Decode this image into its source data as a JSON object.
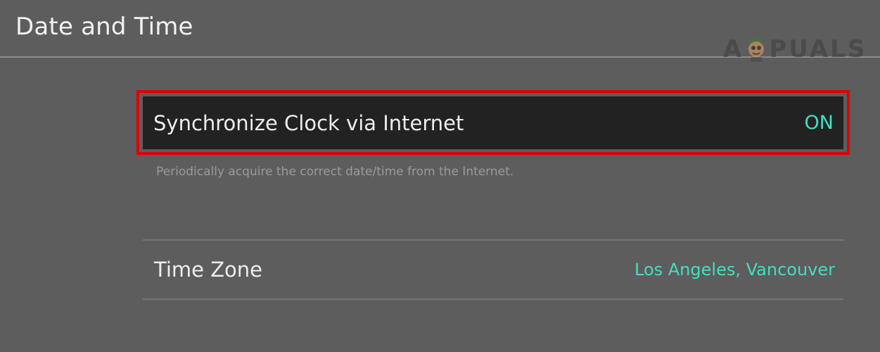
{
  "header": {
    "title": "Date and Time"
  },
  "watermark": {
    "text_left": "A",
    "text_right": "PUALS",
    "mascot_icon": "appuals-mascot-icon"
  },
  "settings": {
    "sync_clock": {
      "label": "Synchronize Clock via Internet",
      "value": "ON",
      "description": "Periodically acquire the correct date/time from the Internet.",
      "highlighted": true
    },
    "time_zone": {
      "label": "Time Zone",
      "value": "Los Angeles, Vancouver"
    }
  },
  "colors": {
    "background": "#5d5d5d",
    "selected_row": "#222222",
    "value_accent": "#40e0c0",
    "highlight_frame": "#e00000"
  }
}
